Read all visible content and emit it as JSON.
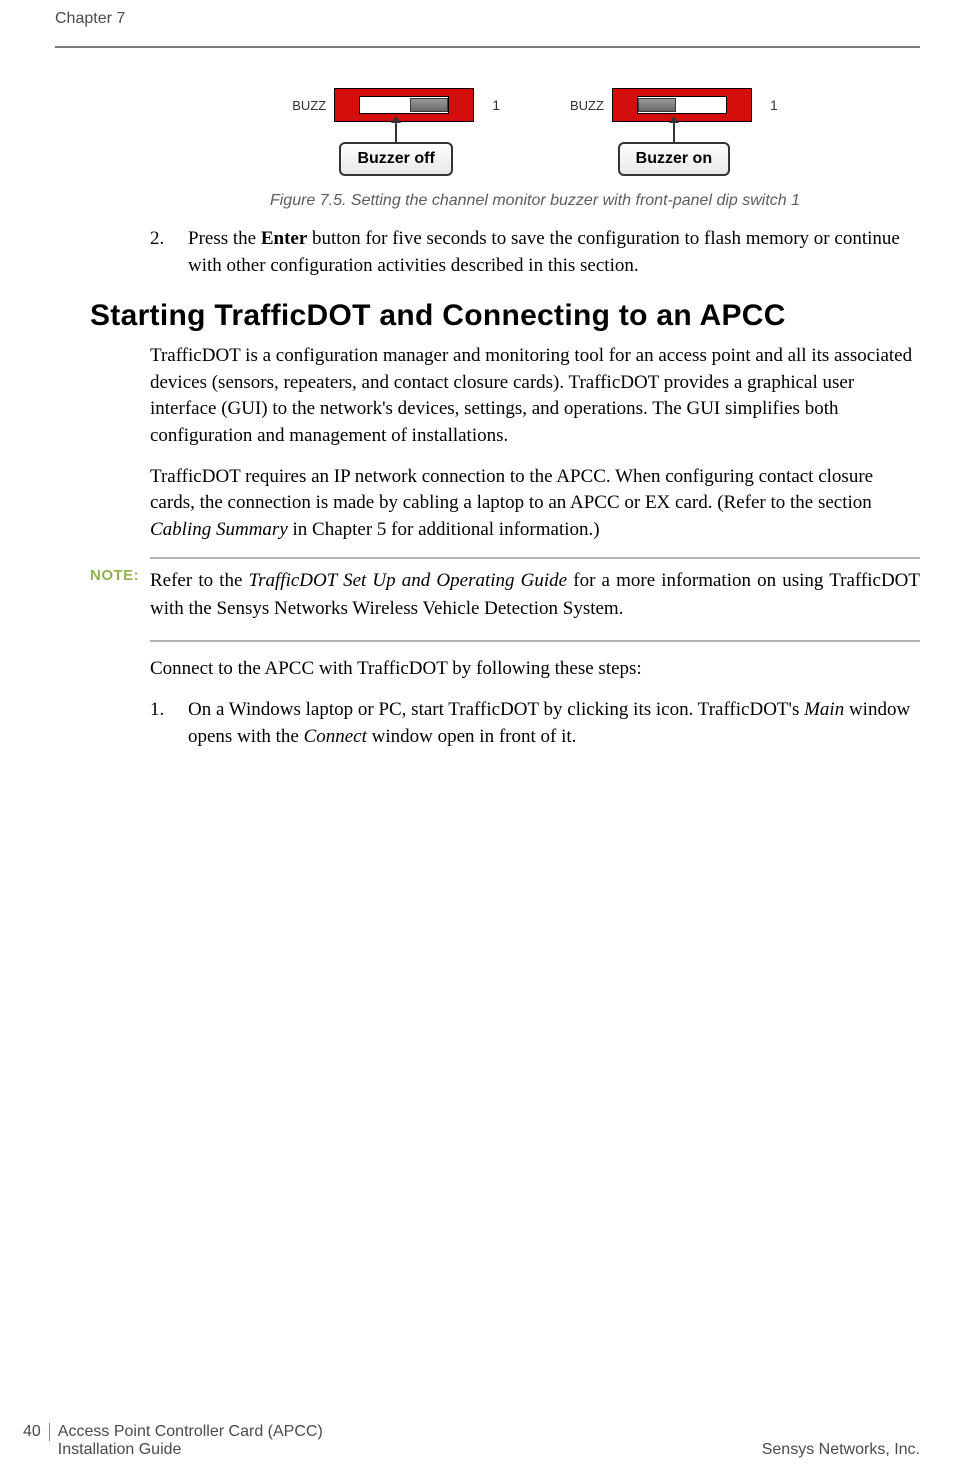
{
  "header": {
    "chapter": "Chapter 7"
  },
  "figure": {
    "buzz_label": "BUZZ",
    "switch_num": "1",
    "off_label": "Buzzer off",
    "on_label": "Buzzer on",
    "caption": "Figure 7.5. Setting the channel monitor buzzer with front-panel dip switch 1"
  },
  "steps1": [
    {
      "num": "2.",
      "pre": "Press the ",
      "bold": "Enter",
      "post": " button for five seconds to save the configuration to flash memory or continue with other configuration activities described in this section."
    }
  ],
  "section": {
    "heading": "Starting TrafficDOT and Connecting to an APCC",
    "p1": "TrafficDOT is a configuration manager and monitoring tool for an access point and all its associated devices (sensors, repeaters, and contact closure cards). TrafficDOT provides a graphical user interface (GUI) to the network's devices, settings, and operations. The GUI simplifies both configuration and management of installations.",
    "p2a": "TrafficDOT requires an IP network connection to the APCC. When configuring contact closure cards, the connection is made by cabling a laptop to an APCC or EX card. (Refer to the section ",
    "p2i": "Cabling Summary",
    "p2b": " in Chapter 5 for additional information.)",
    "p3": "Connect to the APCC with TrafficDOT by following these steps:"
  },
  "note": {
    "label": "NOTE:",
    "t1": "Refer to the ",
    "ti": "TrafficDOT Set Up and Operating Guide",
    "t2": " for a more information on using TrafficDOT with the Sensys Networks Wireless Vehicle Detection System."
  },
  "steps2": [
    {
      "num": "1.",
      "a": "On a Windows laptop or PC, start TrafficDOT by clicking its icon. TrafficDOT's ",
      "i1": "Main",
      "b": " window opens with the ",
      "i2": "Connect",
      "c": " window open in front of it."
    }
  ],
  "footer": {
    "page": "40",
    "title1": "Access Point Controller Card (APCC)",
    "title2": "Installation Guide",
    "company": "Sensys Networks, Inc."
  }
}
